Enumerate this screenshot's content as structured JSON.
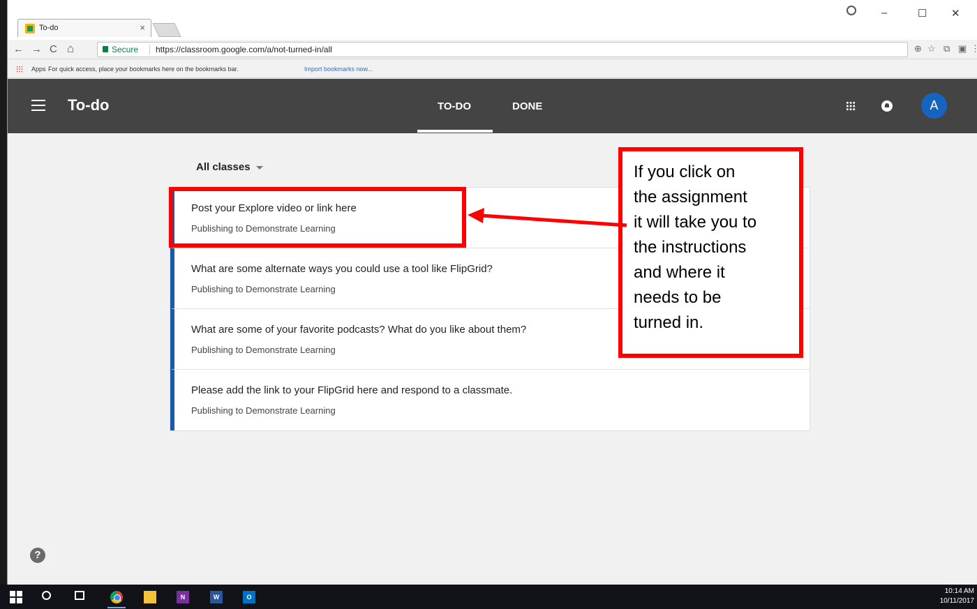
{
  "browser": {
    "tab_title": "To-do",
    "tab_close": "×",
    "window_controls": {
      "minimize": "–",
      "maximize": "☐",
      "close": "✕"
    },
    "nav": {
      "back": "←",
      "forward": "→",
      "reload": "C",
      "home": "⌂"
    },
    "secure_label": "Secure",
    "url": "https://classroom.google.com/a/not-turned-in/all",
    "toolbar_icons": [
      "zoom-icon",
      "star-icon",
      "cast-icon",
      "pdf-icon",
      "menu-dots-icon"
    ],
    "toolbar_glyphs": {
      "zoom": "⊕",
      "star": "☆",
      "cast": "⧉",
      "pdf": "▣",
      "menu": "⋮"
    }
  },
  "bookmarks": {
    "apps_label": "Apps",
    "hint": "For quick access, place your bookmarks here on the bookmarks bar.",
    "import_link": "Import bookmarks now..."
  },
  "header": {
    "title": "To-do",
    "tabs": [
      {
        "label": "TO-DO",
        "active": true
      },
      {
        "label": "DONE",
        "active": false
      }
    ],
    "avatar_initial": "A",
    "colors": {
      "bar": "#444444",
      "avatar": "#1565c0"
    }
  },
  "filter": {
    "label": "All classes"
  },
  "assignments": [
    {
      "title": "Post your Explore video or link here",
      "class": "Publishing to Demonstrate Learning"
    },
    {
      "title": "What are some alternate ways you could use a tool like FlipGrid?",
      "class": "Publishing to Demonstrate Learning"
    },
    {
      "title": "What are some of your favorite podcasts? What do you like about them?",
      "class": "Publishing to Demonstrate Learning"
    },
    {
      "title": "Please add the link to your FlipGrid here and respond to a classmate.",
      "class": "Publishing to Demonstrate Learning"
    }
  ],
  "annotation": {
    "lines": [
      "If you click on",
      "the assignment",
      "it will take you to",
      "the instructions",
      "and where it",
      "needs to be",
      "turned in."
    ],
    "color": "#ff0000"
  },
  "help": {
    "glyph": "?"
  },
  "taskbar": {
    "apps": [
      "start-icon",
      "search-icon",
      "task-view-icon",
      "chrome-icon",
      "file-explorer-icon",
      "onenote-icon",
      "word-icon",
      "outlook-icon"
    ],
    "app_labels": {
      "onenote": "N",
      "word": "W",
      "outlook": "O"
    },
    "time": "10:14 AM",
    "date": "10/11/2017"
  }
}
